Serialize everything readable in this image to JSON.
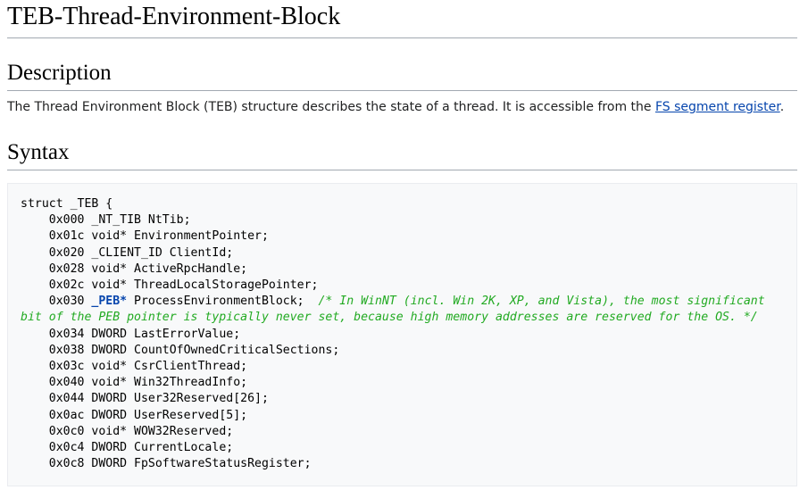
{
  "page": {
    "title": "TEB-Thread-Environment-Block"
  },
  "description": {
    "heading": "Description",
    "text_before_link": "The Thread Environment Block (TEB) structure describes the state of a thread. It is accessible from the ",
    "link_text": "FS segment register",
    "text_after_link": "."
  },
  "syntax": {
    "heading": "Syntax",
    "struct_open": "struct _TEB {",
    "lines": [
      "    0x000 _NT_TIB NtTib;",
      "    0x01c void* EnvironmentPointer;",
      "    0x020 _CLIENT_ID ClientId;",
      "    0x028 void* ActiveRpcHandle;",
      "    0x02c void* ThreadLocalStoragePointer;"
    ],
    "peb_line_prefix": "    0x030 ",
    "peb_type": "_PEB*",
    "peb_line_rest": " ProcessEnvironmentBlock;  ",
    "peb_comment": "/* In WinNT (incl. Win 2K, XP, and Vista), the most significant bit of the PEB pointer is typically never set, because high memory addresses are reserved for the OS. */",
    "lines_after": [
      "    0x034 DWORD LastErrorValue;",
      "    0x038 DWORD CountOfOwnedCriticalSections;",
      "    0x03c void* CsrClientThread;",
      "    0x040 void* Win32ThreadInfo;",
      "    0x044 DWORD User32Reserved[26];",
      "    0x0ac DWORD UserReserved[5];",
      "    0x0c0 void* WOW32Reserved;",
      "    0x0c4 DWORD CurrentLocale;",
      "    0x0c8 DWORD FpSoftwareStatusRegister;"
    ]
  }
}
